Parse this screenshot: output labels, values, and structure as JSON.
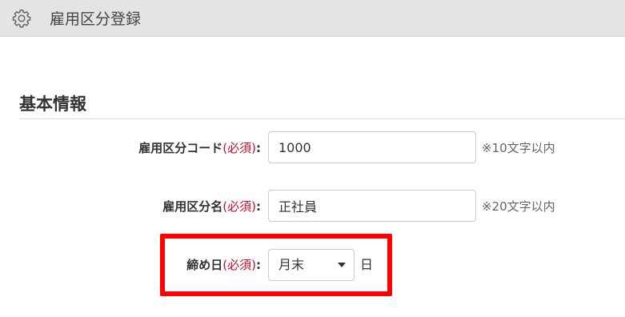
{
  "header": {
    "title": "雇用区分登録",
    "icon": "gear-icon"
  },
  "section": {
    "title": "基本情報"
  },
  "form": {
    "code": {
      "label": "雇用区分コード",
      "required": "(必須)",
      "colon": ":",
      "value": "1000",
      "hint": "※10文字以内"
    },
    "name": {
      "label": "雇用区分名",
      "required": "(必須)",
      "colon": ":",
      "value": "正社員",
      "hint": "※20文字以内"
    },
    "closing_day": {
      "label": "締め日",
      "required": "(必須)",
      "colon": ":",
      "selected": "月末",
      "unit": "日"
    }
  },
  "colors": {
    "header_bg": "#e4e4e4",
    "required": "#c8102e",
    "highlight": "#ff0000"
  }
}
